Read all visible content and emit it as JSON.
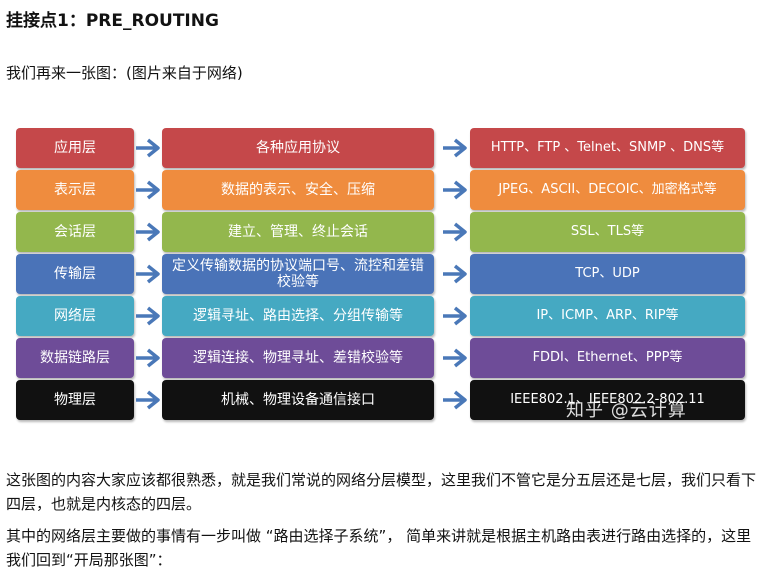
{
  "heading": "挂接点1：PRE_ROUTING",
  "intro": "我们再来一张图：(图片来自于网络)",
  "layers": [
    {
      "name": "应用层",
      "function": "各种应用协议",
      "protocols": "HTTP、FTP 、Telnet、SNMP 、DNS等",
      "color": "#c5484a"
    },
    {
      "name": "表示层",
      "function": "数据的表示、安全、压缩",
      "protocols": "JPEG、ASCII、DECOIC、加密格式等",
      "color": "#ef8c3e"
    },
    {
      "name": "会话层",
      "function": "建立、管理、终止会话",
      "protocols": "SSL、TLS等",
      "color": "#93b74d"
    },
    {
      "name": "传输层",
      "function": "定义传输数据的协议端口号、流控和差错校验等",
      "protocols": "TCP、UDP",
      "color": "#4a73b8"
    },
    {
      "name": "网络层",
      "function": "逻辑寻址、路由选择、分组传输等",
      "protocols": "IP、ICMP、ARP、RIP等",
      "color": "#45a9c2"
    },
    {
      "name": "数据链路层",
      "function": "逻辑连接、物理寻址、差错校验等",
      "protocols": "FDDI、Ethernet、PPP等",
      "color": "#6e4c98"
    },
    {
      "name": "物理层",
      "function": "机械、物理设备通信接口",
      "protocols": "IEEE802.1、IEEE802.2-802.11",
      "color": "#111111"
    }
  ],
  "watermark": "知乎 @云计算",
  "paragraph1": "这张图的内容大家应该都很熟悉，就是我们常说的网络分层模型，这里我们不管它是分五层还是七层，我们只看下四层，也就是内核态的四层。",
  "paragraph2": "其中的网络层主要做的事情有一步叫做 “路由选择子系统”， 简单来讲就是根据主机路由表进行路由选择的，这里我们回到“开局那张图”：",
  "colors": {
    "arrow": "#4a78b8"
  }
}
